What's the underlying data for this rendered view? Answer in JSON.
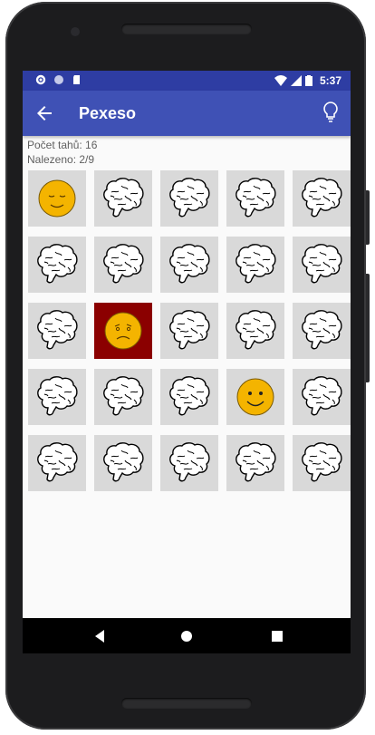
{
  "statusbar": {
    "time": "5:37",
    "icons": [
      "settings-icon",
      "circle-icon",
      "sd-card-icon",
      "wifi-icon",
      "signal-icon",
      "battery-icon"
    ]
  },
  "appbar": {
    "title": "Pexeso",
    "back_icon": "arrow-back-icon",
    "hint_icon": "lightbulb-icon"
  },
  "stats": {
    "moves": "Počet tahů: 16",
    "found": "Nalezeno: 2/9"
  },
  "colors": {
    "primary": "#3f51b5",
    "primary_dark": "#2e3da3",
    "card_bg": "#d9d9d9",
    "card_wrong": "#8b0000",
    "smiley_yellow": "#f4b400"
  },
  "board": {
    "rows": 5,
    "cols": 5,
    "cards": [
      "sleepy-face",
      "brain",
      "brain",
      "brain",
      "brain",
      "brain",
      "brain",
      "brain",
      "brain",
      "brain",
      "brain",
      "sad-face",
      "brain",
      "brain",
      "brain",
      "brain",
      "brain",
      "brain",
      "happy-face",
      "brain",
      "brain",
      "brain",
      "brain",
      "brain",
      "brain"
    ],
    "wrong_card_index": 11
  },
  "navbar": {
    "buttons": [
      "back-triangle-icon",
      "home-circle-icon",
      "recents-square-icon"
    ]
  }
}
